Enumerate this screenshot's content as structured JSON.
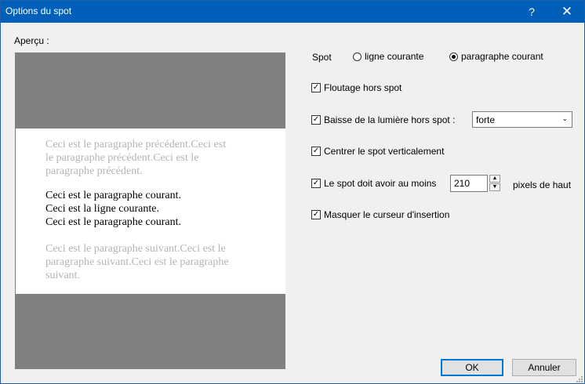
{
  "window": {
    "title": "Options du spot",
    "help_label": "?",
    "close_label": "✕"
  },
  "preview": {
    "label": "Aperçu :",
    "previous_paragraph": "Ceci est le paragraphe précédent.Ceci est le paragraphe précédent.Ceci est le paragraphe précédent.",
    "current_line1": "Ceci est le paragraphe courant.",
    "current_line2": "Ceci est la ligne courante.",
    "current_line3": "Ceci est le paragraphe courant.",
    "next_paragraph": "Ceci est le paragraphe suivant.Ceci est le paragraphe suivant.Ceci est le paragraphe suivant."
  },
  "spot": {
    "label": "Spot",
    "options": [
      {
        "label": "ligne courante",
        "selected": false
      },
      {
        "label": "paragraphe courant",
        "selected": true
      }
    ]
  },
  "options": {
    "blur": {
      "label": "Floutage hors spot",
      "checked": true
    },
    "dim": {
      "label": "Baisse de la lumière hors spot :",
      "checked": true,
      "value": "forte"
    },
    "center": {
      "label": "Centrer le spot verticalement",
      "checked": true
    },
    "min_height": {
      "label": "Le spot doit avoir au moins",
      "checked": true,
      "value": "210",
      "unit": "pixels de haut"
    },
    "hide_cursor": {
      "label": "Masquer le curseur d'insertion",
      "checked": true
    }
  },
  "buttons": {
    "ok": "OK",
    "cancel": "Annuler"
  },
  "icons": {
    "check": "✓",
    "chevron": "⌄",
    "spin_up": "▲",
    "spin_down": "▼"
  }
}
